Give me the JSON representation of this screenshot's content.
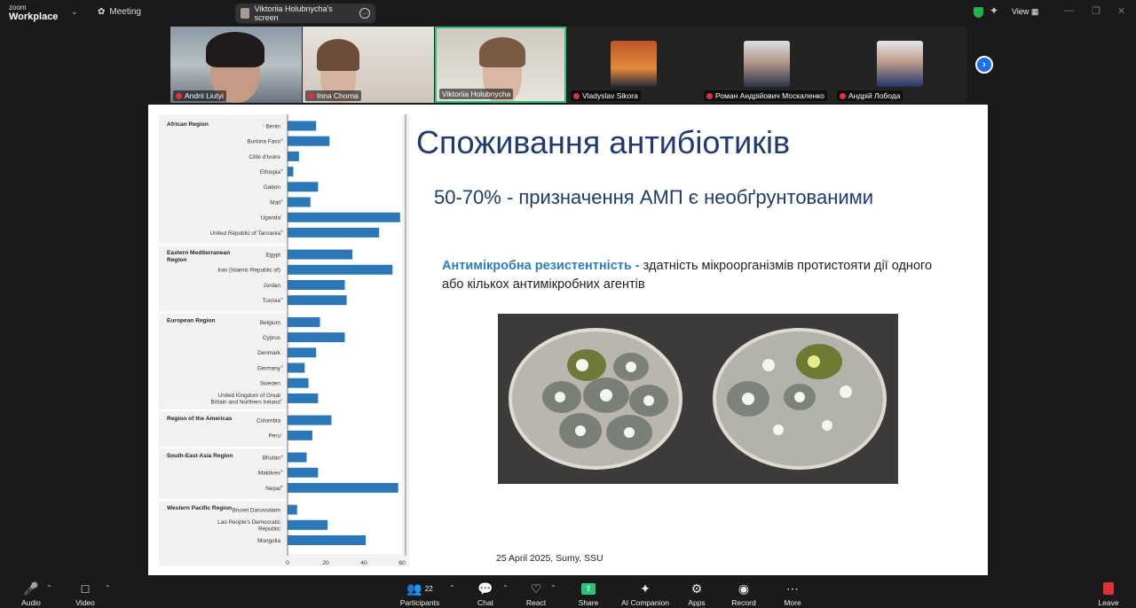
{
  "app": {
    "brand_top": "zoom",
    "brand_bottom": "Workplace",
    "meeting_label": "Meeting",
    "share_label": "Viktoriia Holubnycha's screen",
    "view_label": "View"
  },
  "participants": [
    {
      "name": "Andrii Liutyi"
    },
    {
      "name": "Inna Chorna"
    },
    {
      "name": "Viktoriia Holubnycha"
    },
    {
      "name": "Vladyslav Sikora"
    },
    {
      "name": "Роман Андрійович Москаленко"
    },
    {
      "name": "Андрій Лобода"
    }
  ],
  "slide": {
    "title": "Споживання антибіотиків",
    "subtitle": "50-70% - призначення АМП є необґрунтованими",
    "def_term": "Антимікробна резистентність -",
    "def_text": " здатність мікроорганізмів протистояти дії одного або кількох антимікробних агентів",
    "footer": "25 April 2025,  Sumy, SSU"
  },
  "chart_data": {
    "type": "bar",
    "orientation": "horizontal",
    "xlim": [
      0,
      60
    ],
    "xticks": [
      0,
      20,
      40,
      60
    ],
    "groups": [
      {
        "region": "African Region",
        "items": [
          {
            "country": "Benin",
            "value": 15
          },
          {
            "country": "Burkina Faso",
            "sup": "a",
            "value": 22
          },
          {
            "country": "Côte d'Ivoire",
            "value": 6
          },
          {
            "country": "Ethiopia",
            "sup": "b",
            "value": 3
          },
          {
            "country": "Gabon",
            "value": 16
          },
          {
            "country": "Mali",
            "sup": "b",
            "value": 12
          },
          {
            "country": "Uganda",
            "sup": "i",
            "value": 59
          },
          {
            "country": "United Republic of Tanzania",
            "sup": "b",
            "value": 48
          }
        ]
      },
      {
        "region": "Eastern Mediterranean Region",
        "items": [
          {
            "country": "Egypt",
            "value": 34
          },
          {
            "country": "Iran (Islamic Republic of)",
            "value": 55
          },
          {
            "country": "Jordan",
            "value": 30
          },
          {
            "country": "Tunisia",
            "sup": "b",
            "value": 31
          }
        ]
      },
      {
        "region": "European Region",
        "items": [
          {
            "country": "Belgium",
            "value": 17
          },
          {
            "country": "Cyprus",
            "value": 30
          },
          {
            "country": "Denmark",
            "value": 15
          },
          {
            "country": "Germany",
            "sup": "d",
            "value": 9
          },
          {
            "country": "Sweden",
            "value": 11
          },
          {
            "country": "United Kingdom of Great Britain and Northern Ireland",
            "sup": "f",
            "value": 16
          }
        ]
      },
      {
        "region": "Region of the Americas",
        "items": [
          {
            "country": "Colombia",
            "value": 23
          },
          {
            "country": "Peru",
            "sup": "i",
            "value": 13
          }
        ]
      },
      {
        "region": "South-East Asia Region",
        "items": [
          {
            "country": "Bhutan",
            "sup": "a",
            "value": 10
          },
          {
            "country": "Maldives",
            "sup": "b",
            "value": 16
          },
          {
            "country": "Nepal",
            "sup": "b",
            "value": 58
          }
        ]
      },
      {
        "region": "Western Pacific Region",
        "items": [
          {
            "country": "Brunei Darussalam",
            "value": 5
          },
          {
            "country": "Lao People's Democratic Republic",
            "value": 21
          },
          {
            "country": "Mongolia",
            "value": 41
          }
        ]
      }
    ]
  },
  "toolbar": {
    "audio": "Audio",
    "video": "Video",
    "participants": "Participants",
    "participants_count": "22",
    "chat": "Chat",
    "react": "React",
    "share": "Share",
    "ai": "AI Companion",
    "apps": "Apps",
    "record": "Record",
    "more": "More",
    "leave": "Leave"
  },
  "colors": {
    "bar": "#2b77b8",
    "accent": "#1c6ff5",
    "title": "#1f3a6e",
    "speaker_border": "#2fc27a",
    "danger": "#e0303a"
  }
}
